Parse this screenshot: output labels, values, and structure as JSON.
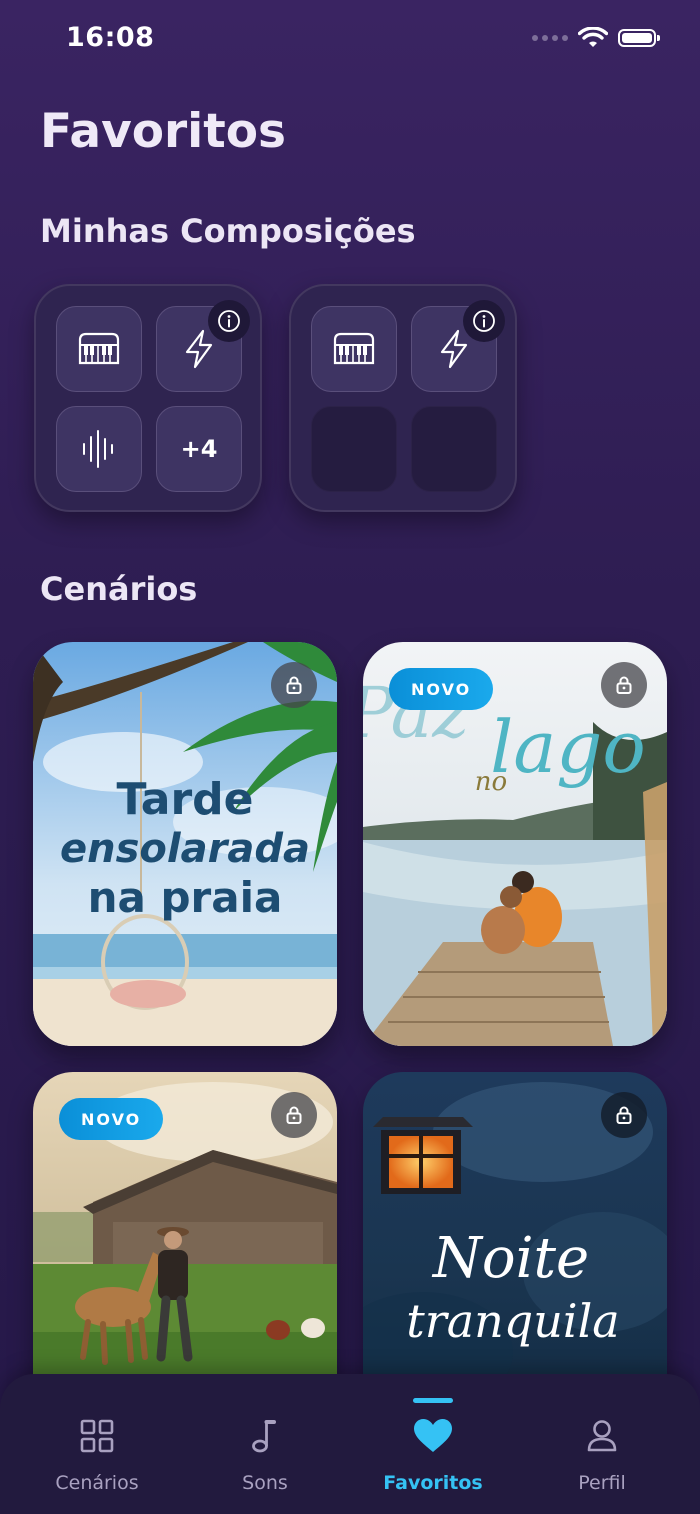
{
  "status_bar": {
    "time": "16:08"
  },
  "page": {
    "title": "Favoritos"
  },
  "compositions": {
    "title": "Minhas Composições",
    "cards": [
      {
        "tiles": [
          "piano-icon",
          "lightning-icon",
          "waveform-icon",
          "+4"
        ]
      },
      {
        "tiles": [
          "piano-icon",
          "lightning-icon",
          "",
          ""
        ]
      }
    ]
  },
  "scenarios": {
    "title": "Cenários",
    "new_label": "NOVO",
    "cards": [
      {
        "title_lines": [
          "Tarde",
          "ensolarada",
          "na praia"
        ],
        "is_new": false,
        "locked": true
      },
      {
        "title_lines": [
          "Paz",
          "no",
          "lago"
        ],
        "is_new": true,
        "locked": true
      },
      {
        "title_lines": [],
        "is_new": true,
        "locked": true
      },
      {
        "title_lines": [
          "Noite",
          "tranquila"
        ],
        "is_new": false,
        "locked": true
      }
    ]
  },
  "tab_bar": {
    "tabs": [
      {
        "label": "Cenários",
        "icon": "grid-icon",
        "active": false
      },
      {
        "label": "Sons",
        "icon": "music-note-icon",
        "active": false
      },
      {
        "label": "Favoritos",
        "icon": "heart-icon",
        "active": true
      },
      {
        "label": "Perfil",
        "icon": "person-icon",
        "active": false
      }
    ]
  },
  "colors": {
    "accent": "#35c2f4",
    "new_badge": "#0a8fd8",
    "background": "#2e1d52"
  }
}
